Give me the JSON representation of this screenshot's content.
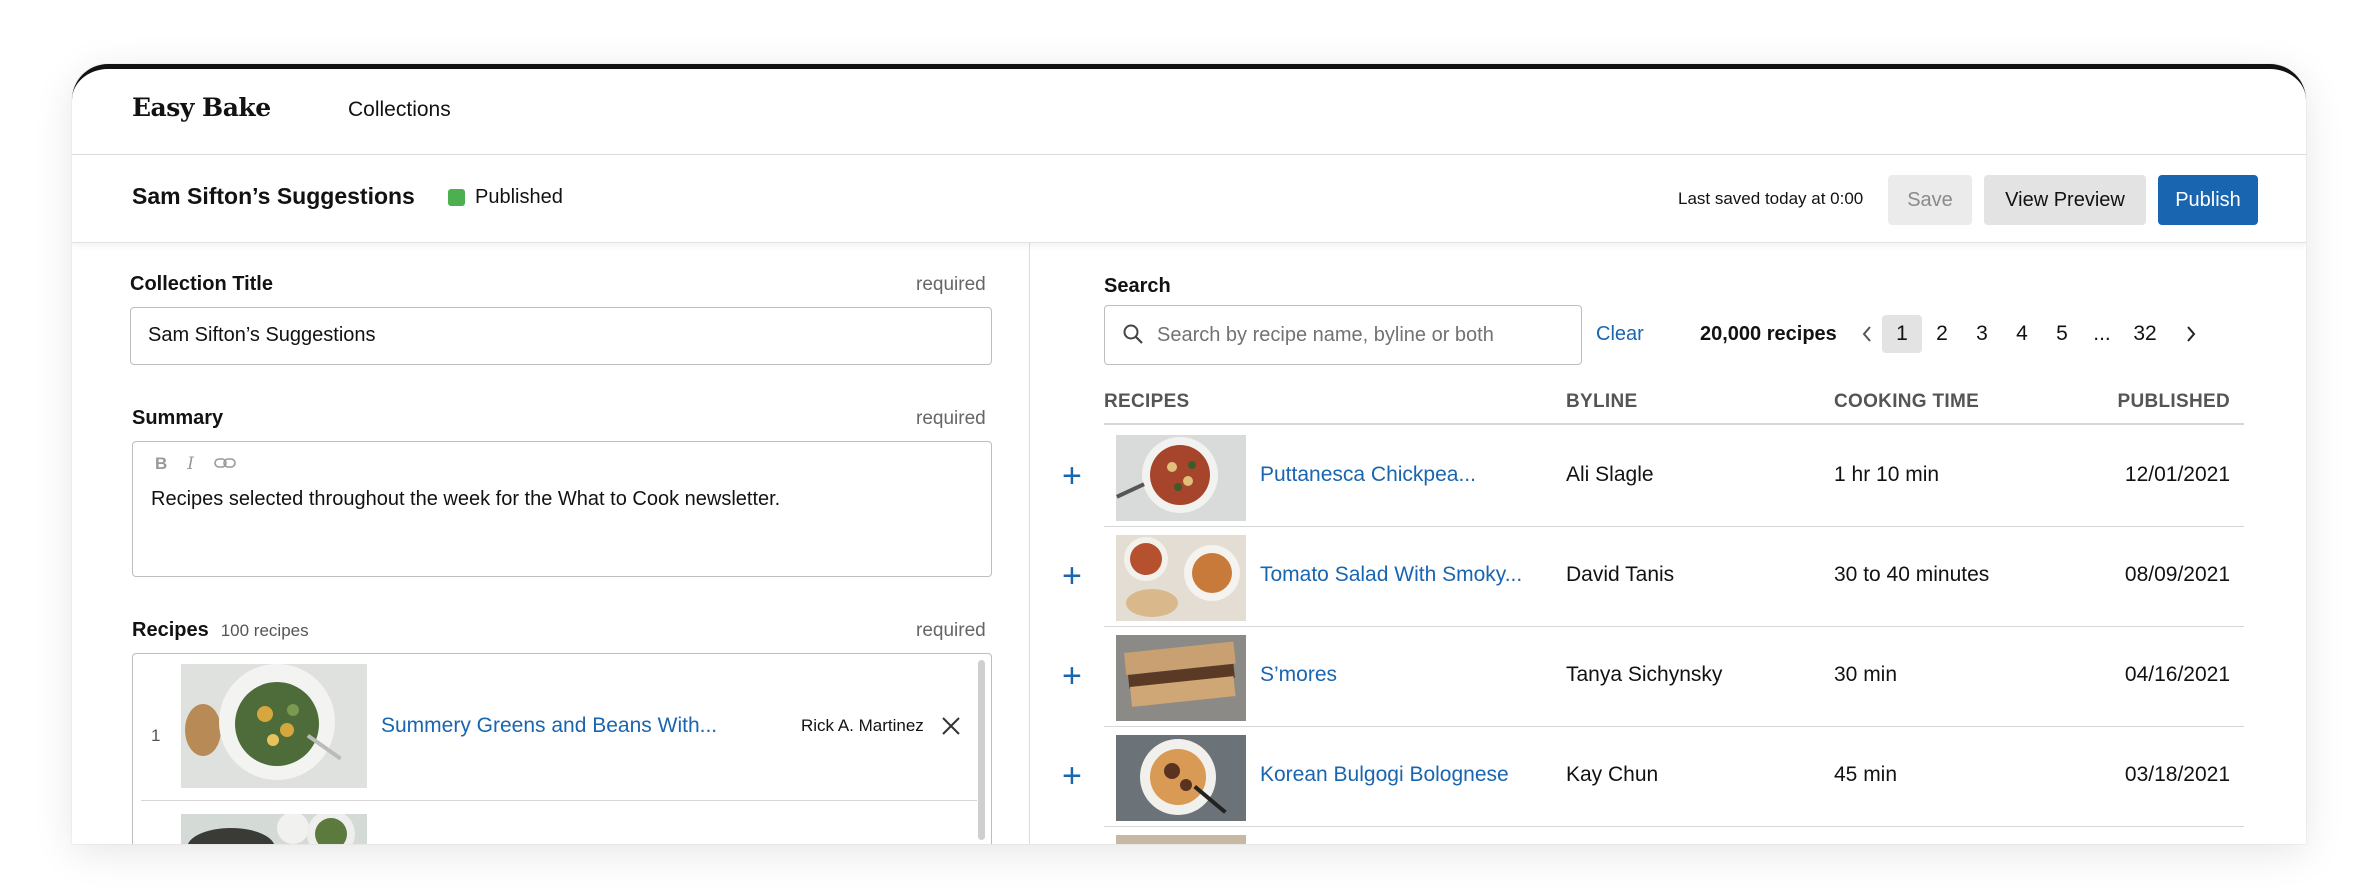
{
  "nav": {
    "logo": "Easy Bake",
    "collections": "Collections"
  },
  "header": {
    "title": "Sam Sifton’s Suggestions",
    "status": "Published",
    "status_color": "#4caf50",
    "last_saved": "Last saved today at 0:00",
    "save_label": "Save",
    "preview_label": "View Preview",
    "publish_label": "Publish",
    "accent_color": "#1a65b0"
  },
  "form": {
    "collection_title_label": "Collection Title",
    "collection_title_required": "required",
    "collection_title_value": "Sam Sifton’s Suggestions",
    "summary_label": "Summary",
    "summary_required": "required",
    "summary_value": "Recipes selected throughout the week for the What to Cook newsletter.",
    "summary_tools": [
      "bold-icon",
      "italic-icon",
      "link-icon"
    ],
    "recipes_label": "Recipes",
    "recipes_count": "100 recipes",
    "recipes_required": "required",
    "selected_recipes": [
      {
        "index": "1",
        "title": "Summery Greens and Beans With...",
        "byline": "Rick A. Martinez"
      }
    ]
  },
  "search": {
    "label": "Search",
    "placeholder": "Search by recipe name, byline or both",
    "clear_label": "Clear",
    "result_count": "20,000 recipes",
    "pages": [
      "1",
      "2",
      "3",
      "4",
      "5",
      "...",
      "32"
    ],
    "current_page": "1"
  },
  "table": {
    "columns": [
      "RECIPES",
      "BYLINE",
      "COOKING TIME",
      "PUBLISHED"
    ],
    "rows": [
      {
        "title": "Puttanesca Chickpea...",
        "byline": "Ali Slagle",
        "time": "1 hr 10 min",
        "published": "12/01/2021"
      },
      {
        "title": "Tomato Salad With Smoky...",
        "byline": "David Tanis",
        "time": "30 to 40 minutes",
        "published": "08/09/2021"
      },
      {
        "title": "S’mores",
        "byline": "Tanya Sichynsky",
        "time": "30 min",
        "published": "04/16/2021"
      },
      {
        "title": "Korean Bulgogi Bolognese",
        "byline": "Kay Chun",
        "time": "45 min",
        "published": "03/18/2021"
      }
    ]
  }
}
